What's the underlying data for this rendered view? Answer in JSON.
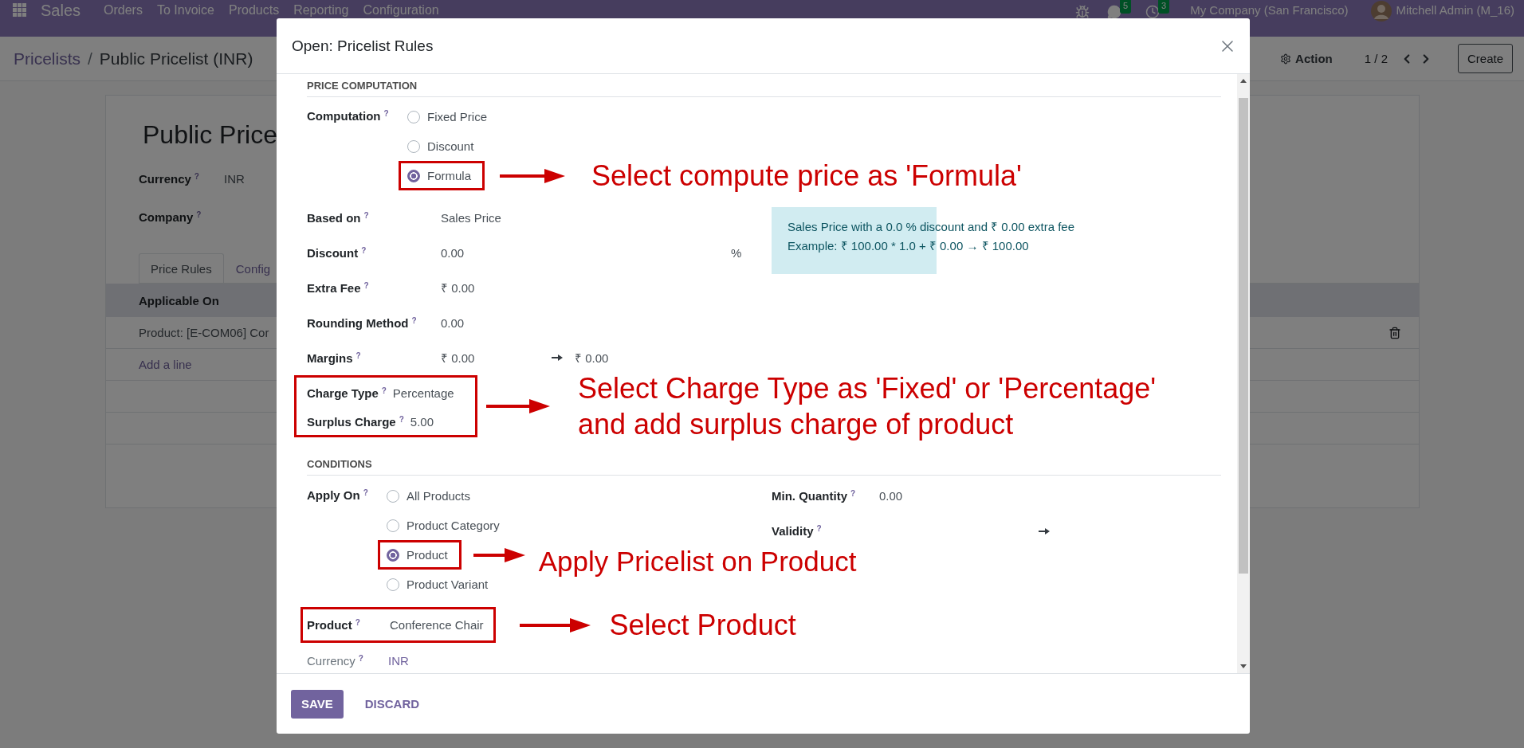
{
  "navbar": {
    "app": "Sales",
    "menu": [
      "Orders",
      "To Invoice",
      "Products",
      "Reporting",
      "Configuration"
    ],
    "chat_count": "5",
    "activity_count": "3",
    "company": "My Company (San Francisco)",
    "user": "Mitchell Admin (M_16)"
  },
  "control_panel": {
    "breadcrumbs": [
      "Pricelists",
      "Public Pricelist (INR)"
    ],
    "separator": "/",
    "action": "Action",
    "pager": "1 / 2",
    "create": "Create"
  },
  "form": {
    "title": "Public Price",
    "fields": [
      {
        "label": "Currency",
        "help": "?",
        "value": "INR"
      },
      {
        "label": "Company",
        "help": "?"
      }
    ],
    "tabs": [
      {
        "label": "Price Rules",
        "selected": true
      },
      {
        "label": "Config",
        "selected": false
      }
    ],
    "table": {
      "columns": [
        "Applicable On"
      ],
      "rows": [
        "Product: [E-COM06] Cor"
      ],
      "add_line": "Add a line"
    }
  },
  "dialog": {
    "title": "Open: Pricelist Rules",
    "price_computation": {
      "heading": "PRICE COMPUTATION",
      "computation": {
        "label": "Computation",
        "help": "?",
        "options": [
          {
            "label": "Fixed Price",
            "selected": false,
            "highlighted": false
          },
          {
            "label": "Discount",
            "selected": false,
            "highlighted": false
          },
          {
            "label": "Formula",
            "selected": true,
            "highlighted": true,
            "callout": "Select compute price as 'Formula'"
          }
        ]
      },
      "fields": [
        {
          "label": "Based on",
          "help": "?",
          "value": "Sales Price"
        },
        {
          "label": "Discount",
          "help": "?",
          "value": "0.00",
          "suffix": "%"
        },
        {
          "label": "Extra Fee",
          "help": "?",
          "value": "₹ 0.00"
        },
        {
          "label": "Rounding Method",
          "help": "?",
          "value": "0.00"
        },
        {
          "label": "Margins",
          "help": "?",
          "value": "₹ 0.00",
          "value_to": "₹ 0.00"
        }
      ],
      "info": [
        "Sales Price with a 0.0 % discount and ₹ 0.00 extra fee",
        "Example: ₹ 100.00 * 1.0 + ₹ 0.00 → ₹ 100.00"
      ],
      "surcharge": {
        "highlighted": true,
        "fields": [
          {
            "label": "Charge Type",
            "help": "?",
            "value": "Percentage"
          },
          {
            "label": "Surplus Charge",
            "help": "?",
            "value": "5.00"
          }
        ],
        "callout": [
          "Select Charge Type as 'Fixed' or 'Percentage'",
          "and add surplus charge of product"
        ]
      }
    },
    "conditions": {
      "heading": "CONDITIONS",
      "apply_on": {
        "label": "Apply On",
        "help": "?",
        "options": [
          {
            "label": "All Products",
            "selected": false,
            "highlighted": false
          },
          {
            "label": "Product Category",
            "selected": false,
            "highlighted": false
          },
          {
            "label": "Product",
            "selected": true,
            "highlighted": true,
            "callout": "Apply Pricelist on Product"
          },
          {
            "label": "Product Variant",
            "selected": false,
            "highlighted": false
          }
        ]
      },
      "min_quantity": {
        "label": "Min. Quantity",
        "help": "?",
        "value": "0.00"
      },
      "validity": {
        "label": "Validity",
        "help": "?"
      },
      "product": {
        "label": "Product",
        "help": "?",
        "value": "Conference Chair",
        "highlighted": true,
        "callout": "Select Product"
      },
      "currency": {
        "label": "Currency",
        "help": "?",
        "value": "INR"
      }
    },
    "buttons": [
      {
        "label": "SAVE",
        "kind": "primary"
      },
      {
        "label": "DISCARD",
        "kind": "link"
      }
    ]
  }
}
